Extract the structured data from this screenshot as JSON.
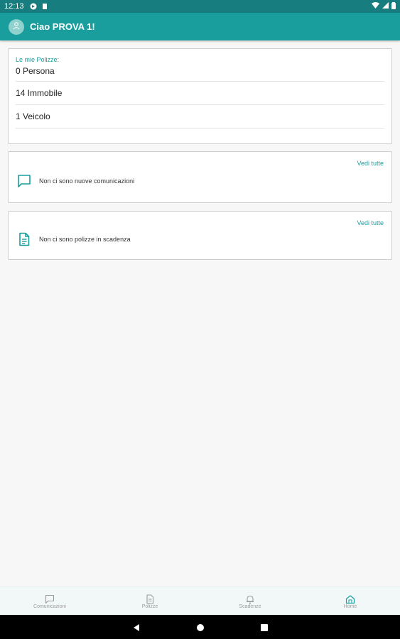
{
  "status_bar": {
    "time": "12:13"
  },
  "header": {
    "title": "Ciao PROVA 1!"
  },
  "policies_card": {
    "label": "Le mie Polizze:",
    "rows": [
      "0 Persona",
      "14 Immobile",
      "1 Veicolo"
    ]
  },
  "communications_card": {
    "link_label": "Vedi tutte",
    "message": "Non ci sono nuove comunicazioni"
  },
  "expiry_card": {
    "link_label": "Vedi tutte",
    "message": "Non ci sono polizze in scadenza"
  },
  "bottom_nav": {
    "items": [
      {
        "label": "Comunicazioni",
        "icon": "chat-icon"
      },
      {
        "label": "Polizze",
        "icon": "document-icon"
      },
      {
        "label": "Scadenze",
        "icon": "bell-icon"
      },
      {
        "label": "Home",
        "icon": "home-icon"
      }
    ],
    "active_index": 3
  },
  "colors": {
    "status_bar": "#177d7f",
    "app_bar": "#1a9e9d",
    "accent": "#1a9e9d",
    "background": "#f7f7f7"
  }
}
